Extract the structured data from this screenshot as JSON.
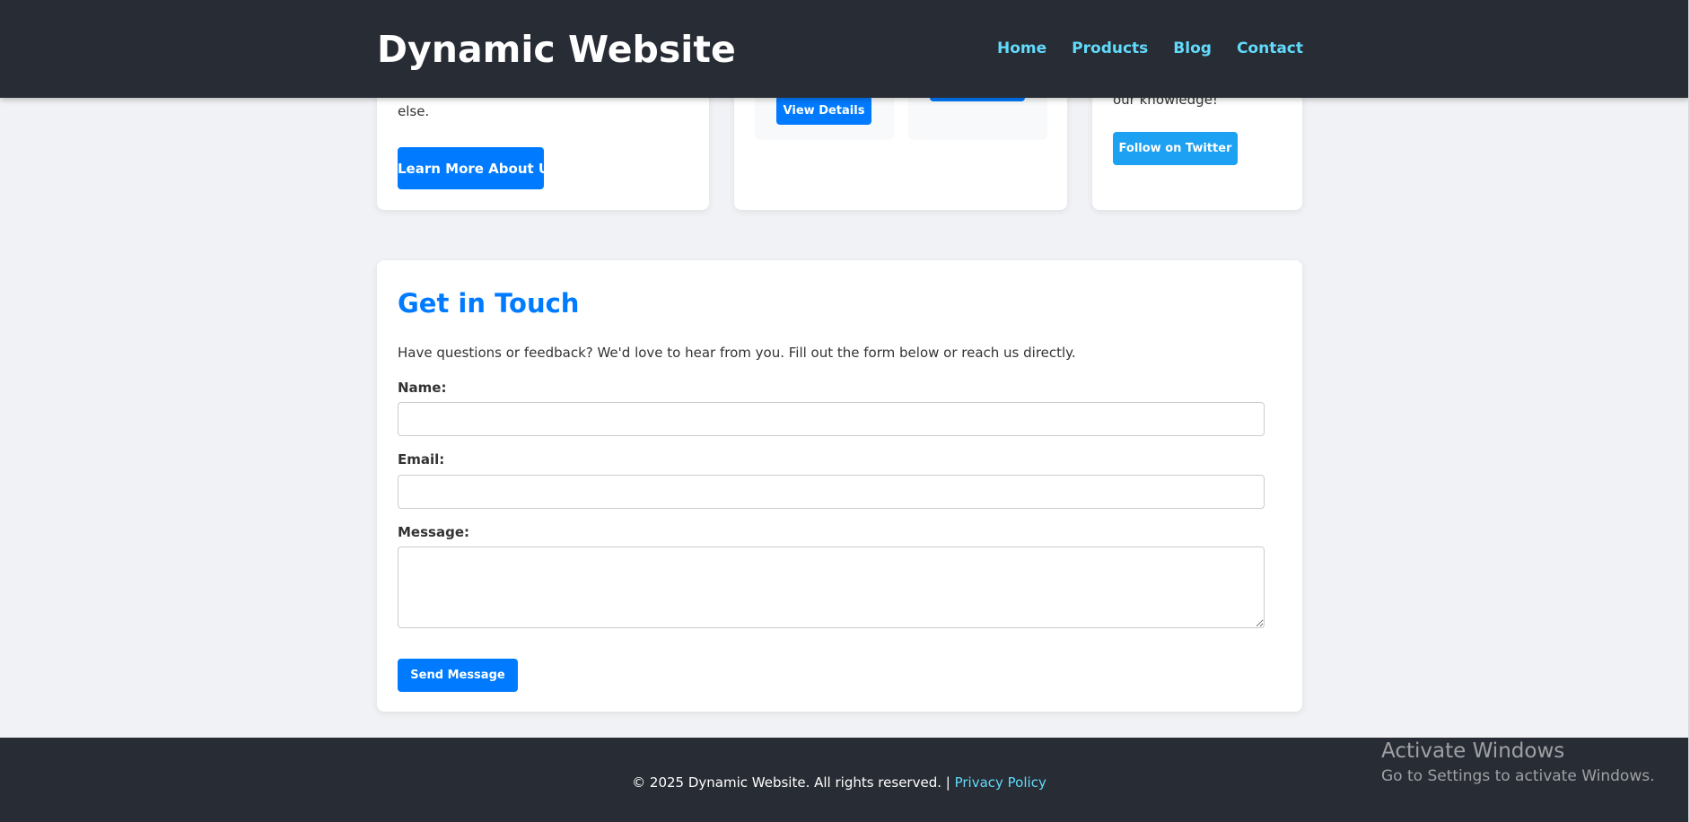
{
  "header": {
    "site_title": "Dynamic Website",
    "nav": [
      "Home",
      "Products",
      "Blog",
      "Contact"
    ]
  },
  "about_card": {
    "text_tail": "else.",
    "button_label": "Learn More About Us"
  },
  "products_card": {
    "view_details_label": "View Details"
  },
  "social_card": {
    "text_tail": "our knowledge!",
    "button_label": "Follow on Twitter"
  },
  "contact": {
    "title": "Get in Touch",
    "intro": "Have questions or feedback? We'd love to hear from you. Fill out the form below or reach us directly.",
    "name_label": "Name:",
    "name_value": "",
    "email_label": "Email:",
    "email_value": "",
    "message_label": "Message:",
    "message_value": "",
    "send_label": "Send Message"
  },
  "footer": {
    "copyright": "© 2025 Dynamic Website. All rights reserved. |",
    "privacy_link": "Privacy Policy"
  },
  "watermark": {
    "title": "Activate Windows",
    "subtitle": "Go to Settings to activate Windows."
  },
  "colors": {
    "header_bg": "#282c34",
    "accent": "#007bff",
    "nav_link": "#61dafb",
    "twitter": "#1da1f2",
    "page_bg": "#f0f2f5"
  }
}
